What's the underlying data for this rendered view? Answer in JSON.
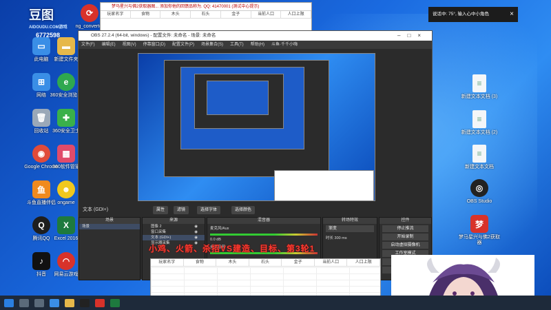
{
  "desktop": {
    "brand": {
      "logo": "豆图",
      "url": "AIDOUDU.COM游戏",
      "number": "6772598"
    },
    "left_icons": [
      {
        "label": "此电脑",
        "color": "#3a8ee6"
      },
      {
        "label": "新建文件夹",
        "color": "#e6b84a"
      },
      {
        "label": "网络",
        "color": "#3a8ee6"
      },
      {
        "label": "360安全浏览器",
        "color": "#2fa84f"
      },
      {
        "label": "回收站",
        "color": "#9aa8b8"
      },
      {
        "label": "360安全卫士",
        "color": "#3ab04a"
      },
      {
        "label": "Google Chrome",
        "color": "#e04b3a"
      },
      {
        "label": "360软件管家",
        "color": "#e04b6a"
      },
      {
        "label": "斗鱼直播伴侣",
        "color": "#f08a1e"
      },
      {
        "label": "ongame",
        "color": "#f0c81e"
      },
      {
        "label": "腾讯QQ",
        "color": "#1e1e1e"
      },
      {
        "label": "Excel 2016",
        "color": "#1e7a3e"
      },
      {
        "label": "抖音",
        "color": "#111111"
      },
      {
        "label": "网易云游戏",
        "color": "#d8322a"
      }
    ],
    "right_icons": [
      {
        "label": "新建文本文档 (3)"
      },
      {
        "label": "新建文本文档 (2)"
      },
      {
        "label": "新建文本文档"
      },
      {
        "label": "OBS Studio"
      },
      {
        "label": "梦马星兴与佛2获取器"
      }
    ],
    "top_icon": {
      "label": "ng_converter"
    }
  },
  "excel_top": {
    "title": "梦马星兴与佛2获取器图... 添加你他的回馈品称为. QQ: 41470001 (测试中心提示)",
    "columns": [
      "玩家名字",
      "食物",
      "木头",
      "石头",
      "金子",
      "当前人口",
      "人口上限"
    ]
  },
  "notice": {
    "text": "说话中: 75°, 输入心中小角色",
    "close": "×"
  },
  "obs": {
    "title": "OBS 27.2.4 (64-bit, windows) - 配置文件: 未命名 - 场景: 未命名",
    "menu": [
      "文件(F)",
      "编辑(E)",
      "视图(V)",
      "停靠窗口(D)",
      "配置文件(P)",
      "场景集合(S)",
      "工具(T)",
      "帮助(H)",
      "斗鱼·千千小嗨"
    ],
    "text_label": "文本 (GDI+)",
    "btn_properties": "属性",
    "btn_filters": "滤镜",
    "btn_select_font": "选择字体",
    "btn_select_color": "选择颜色",
    "scenes": {
      "header": "场景",
      "items": [
        "场景"
      ]
    },
    "sources": {
      "header": "来源",
      "items": [
        "图像 2",
        "窗口采集",
        "文本 (GDI+)",
        "显示器采集"
      ]
    },
    "mixer": {
      "header": "混音器",
      "channels": [
        "麦克风/Aux",
        "桌面音频"
      ],
      "db": "0.0 dB"
    },
    "transitions": {
      "header": "转场特效",
      "type": "渐变",
      "duration_label": "时长",
      "duration": "300 ms"
    },
    "controls": {
      "header": "控件",
      "buttons": [
        "停止推流",
        "开始录制",
        "启动虚拟摄像机",
        "工作室模式",
        "设置",
        "退出"
      ]
    }
  },
  "overlay_text": "小鸡、火箭、杀招VS建造、目标、第3轮1",
  "bottom_excel": {
    "columns": [
      "玩家名字",
      "食物",
      "木头",
      "石头",
      "金子",
      "当前人口",
      "人口上限"
    ]
  }
}
